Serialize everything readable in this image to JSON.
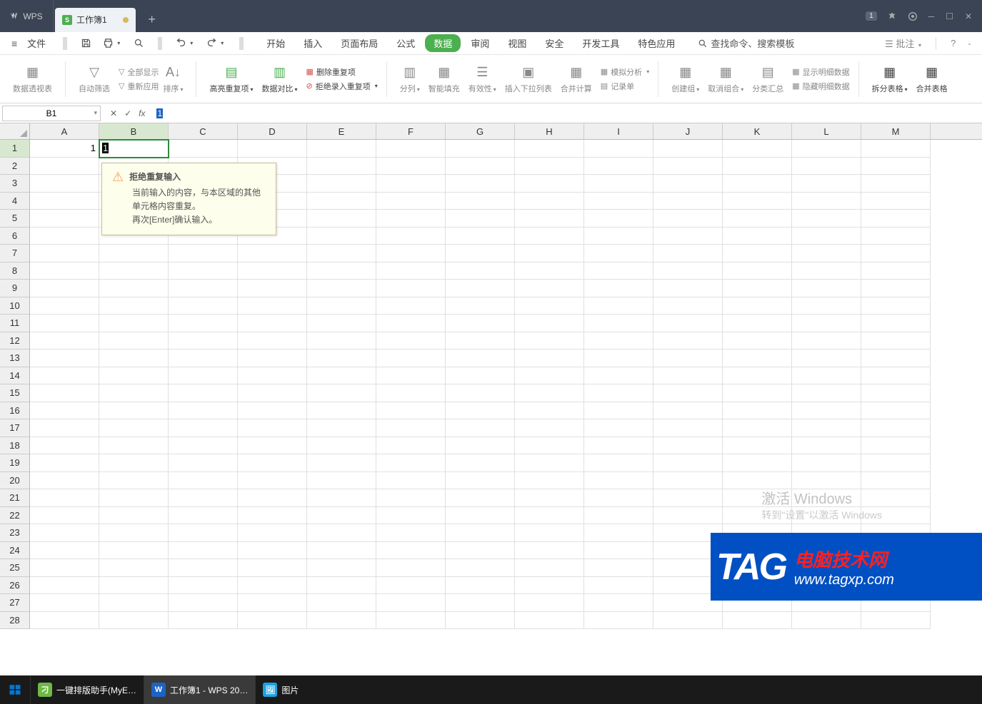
{
  "titlebar": {
    "wps_label": "WPS",
    "doc_name": "工作簿1",
    "badge": "1"
  },
  "menu": {
    "file": "文件",
    "items": [
      "开始",
      "插入",
      "页面布局",
      "公式",
      "数据",
      "审阅",
      "视图",
      "安全",
      "开发工具",
      "特色应用"
    ],
    "active_index": 4,
    "search": "查找命令、搜索模板",
    "comment": "批注"
  },
  "ribbon": {
    "pivot": "数据透视表",
    "autofilter": "自动筛选",
    "show_all": "全部显示",
    "reapply": "重新应用",
    "sort": "排序",
    "highlight": "高亮重复项",
    "compare": "数据对比",
    "remove_dup": "删除重复项",
    "reject_dup": "拒绝录入重复项",
    "split_col": "分列",
    "flash_fill": "智能填充",
    "validation": "有效性",
    "dropdown": "插入下拉列表",
    "consolidate": "合并计算",
    "whatif": "模拟分析",
    "form": "记录单",
    "group_create": "创建组",
    "group_remove": "取消组合",
    "subtotal": "分类汇总",
    "show_detail": "显示明细数据",
    "hide_detail": "隐藏明细数据",
    "split_table": "拆分表格",
    "merge_table": "合并表格"
  },
  "formula": {
    "name_box": "B1",
    "fx_value": "1"
  },
  "grid": {
    "cols": [
      "A",
      "B",
      "C",
      "D",
      "E",
      "F",
      "G",
      "H",
      "I",
      "J",
      "K",
      "L",
      "M"
    ],
    "row_count": 28,
    "a1_value": "1",
    "b1_value": "1",
    "active_col": 1,
    "active_row": 0
  },
  "tooltip": {
    "title": "拒绝重复输入",
    "line1": "当前输入的内容，与本区域的其他单元格内容重复。",
    "line2": "再次[Enter]确认输入。"
  },
  "watermark": {
    "line1": "激活 Windows",
    "line2": "转到\"设置\"以激活 Windows"
  },
  "tag": {
    "label": "TAG",
    "text1": "电脑技术网",
    "text2": "www.tagxp.com"
  },
  "taskbar": {
    "item1": "一键排版助手(MyE…",
    "item2": "工作簿1 - WPS 20…",
    "item3": "图片"
  }
}
